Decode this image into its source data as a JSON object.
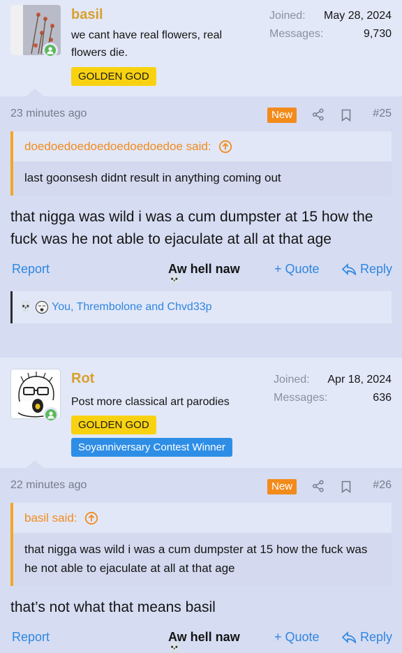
{
  "posts": [
    {
      "author": {
        "name": "basil",
        "title": "we cant have real flowers, real flowers die.",
        "rank": "GOLDEN GOD",
        "joined_label": "Joined:",
        "joined": "May 28, 2024",
        "messages_label": "Messages:",
        "messages": "9,730"
      },
      "time": "23 minutes ago",
      "new_label": "New",
      "number": "#25",
      "quote": {
        "attribution": "doedoedoedoedoedoedoedoe said:",
        "text": "last goonsesh didnt result in anything coming out"
      },
      "message": "that nigga was wild i was a cum dumpster at 15 how the fuck was he not able to ejaculate at all at that age",
      "actions": {
        "report": "Report",
        "reaction": "Aw hell naw",
        "quote": "+ Quote",
        "reply": "Reply"
      },
      "reactors": "You, Thrembolone and Chvd33p"
    },
    {
      "author": {
        "name": "Rot",
        "title": "Post more classical art parodies",
        "rank": "GOLDEN GOD",
        "award": "Soyanniversary Contest Winner",
        "joined_label": "Joined:",
        "joined": "Apr 18, 2024",
        "messages_label": "Messages:",
        "messages": "636"
      },
      "time": "22 minutes ago",
      "new_label": "New",
      "number": "#26",
      "quote": {
        "attribution": "basil said:",
        "text": "that nigga was wild i was a cum dumpster at 15 how the fuck was he not able to ejaculate at all at that age"
      },
      "message": "that’s not what that means basil",
      "actions": {
        "report": "Report",
        "reaction": "Aw hell naw",
        "quote": "+ Quote",
        "reply": "Reply"
      }
    }
  ],
  "icons": [
    "online-user-icon",
    "share-icon",
    "bookmark-icon",
    "expand-quote-icon",
    "skull-icon",
    "reply-arrow-icon"
  ],
  "colors": {
    "background": "#d6dcf2",
    "username": "#d7a02c",
    "link": "#2f86e0",
    "new_badge": "#f28b1c",
    "quote_accent": "#f5a623",
    "golden_god": "#f8d210",
    "award": "#2e8ee6",
    "online": "#5cb85c"
  }
}
